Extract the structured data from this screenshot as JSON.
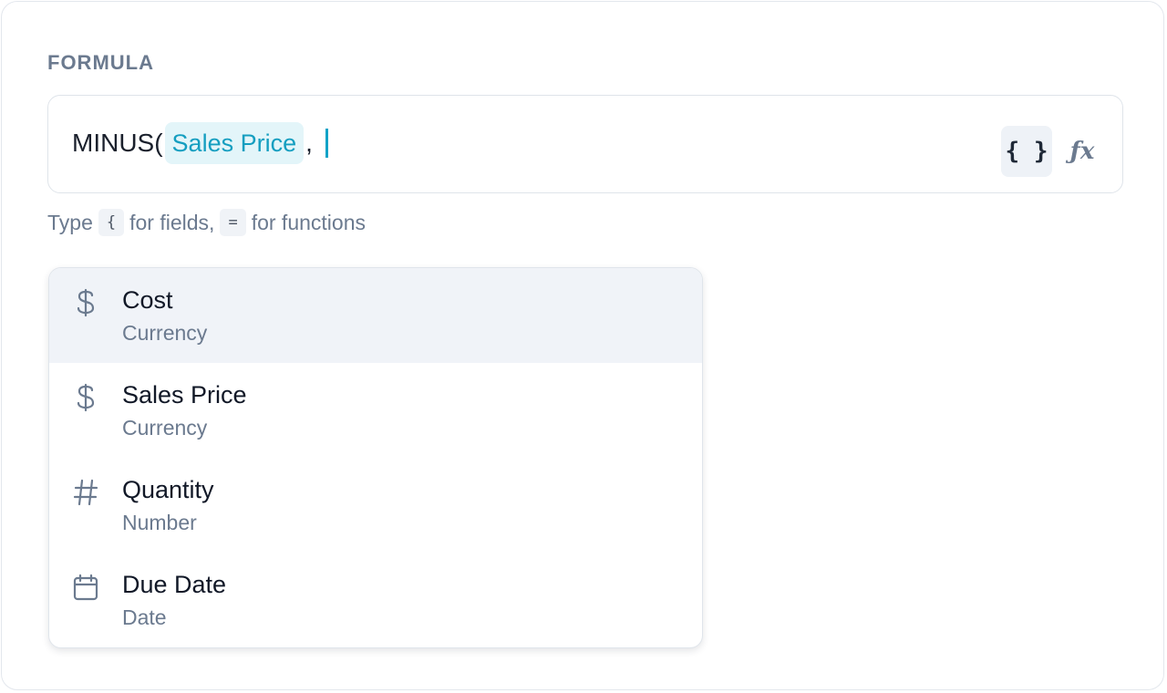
{
  "editor": {
    "label": "FORMULA",
    "function_name": "MINUS(",
    "field_token": "Sales Price",
    "after_token": ",",
    "fields_button_label": "{ }",
    "functions_button_label": "ƒx"
  },
  "hint": {
    "prefix": "Type",
    "fields_key": "{",
    "middle": "for fields,",
    "functions_key": "=",
    "suffix": "for functions"
  },
  "suggestions": [
    {
      "name": "Cost",
      "type": "Currency",
      "icon": "dollar-icon",
      "active": true
    },
    {
      "name": "Sales Price",
      "type": "Currency",
      "icon": "dollar-icon",
      "active": false
    },
    {
      "name": "Quantity",
      "type": "Number",
      "icon": "hash-icon",
      "active": false
    },
    {
      "name": "Due Date",
      "type": "Date",
      "icon": "calendar-icon",
      "active": false
    }
  ],
  "colors": {
    "accent": "#149ec0",
    "chip_bg": "#e3f5f9",
    "muted_text": "#6b7a8f",
    "active_row": "#f0f3f8"
  }
}
